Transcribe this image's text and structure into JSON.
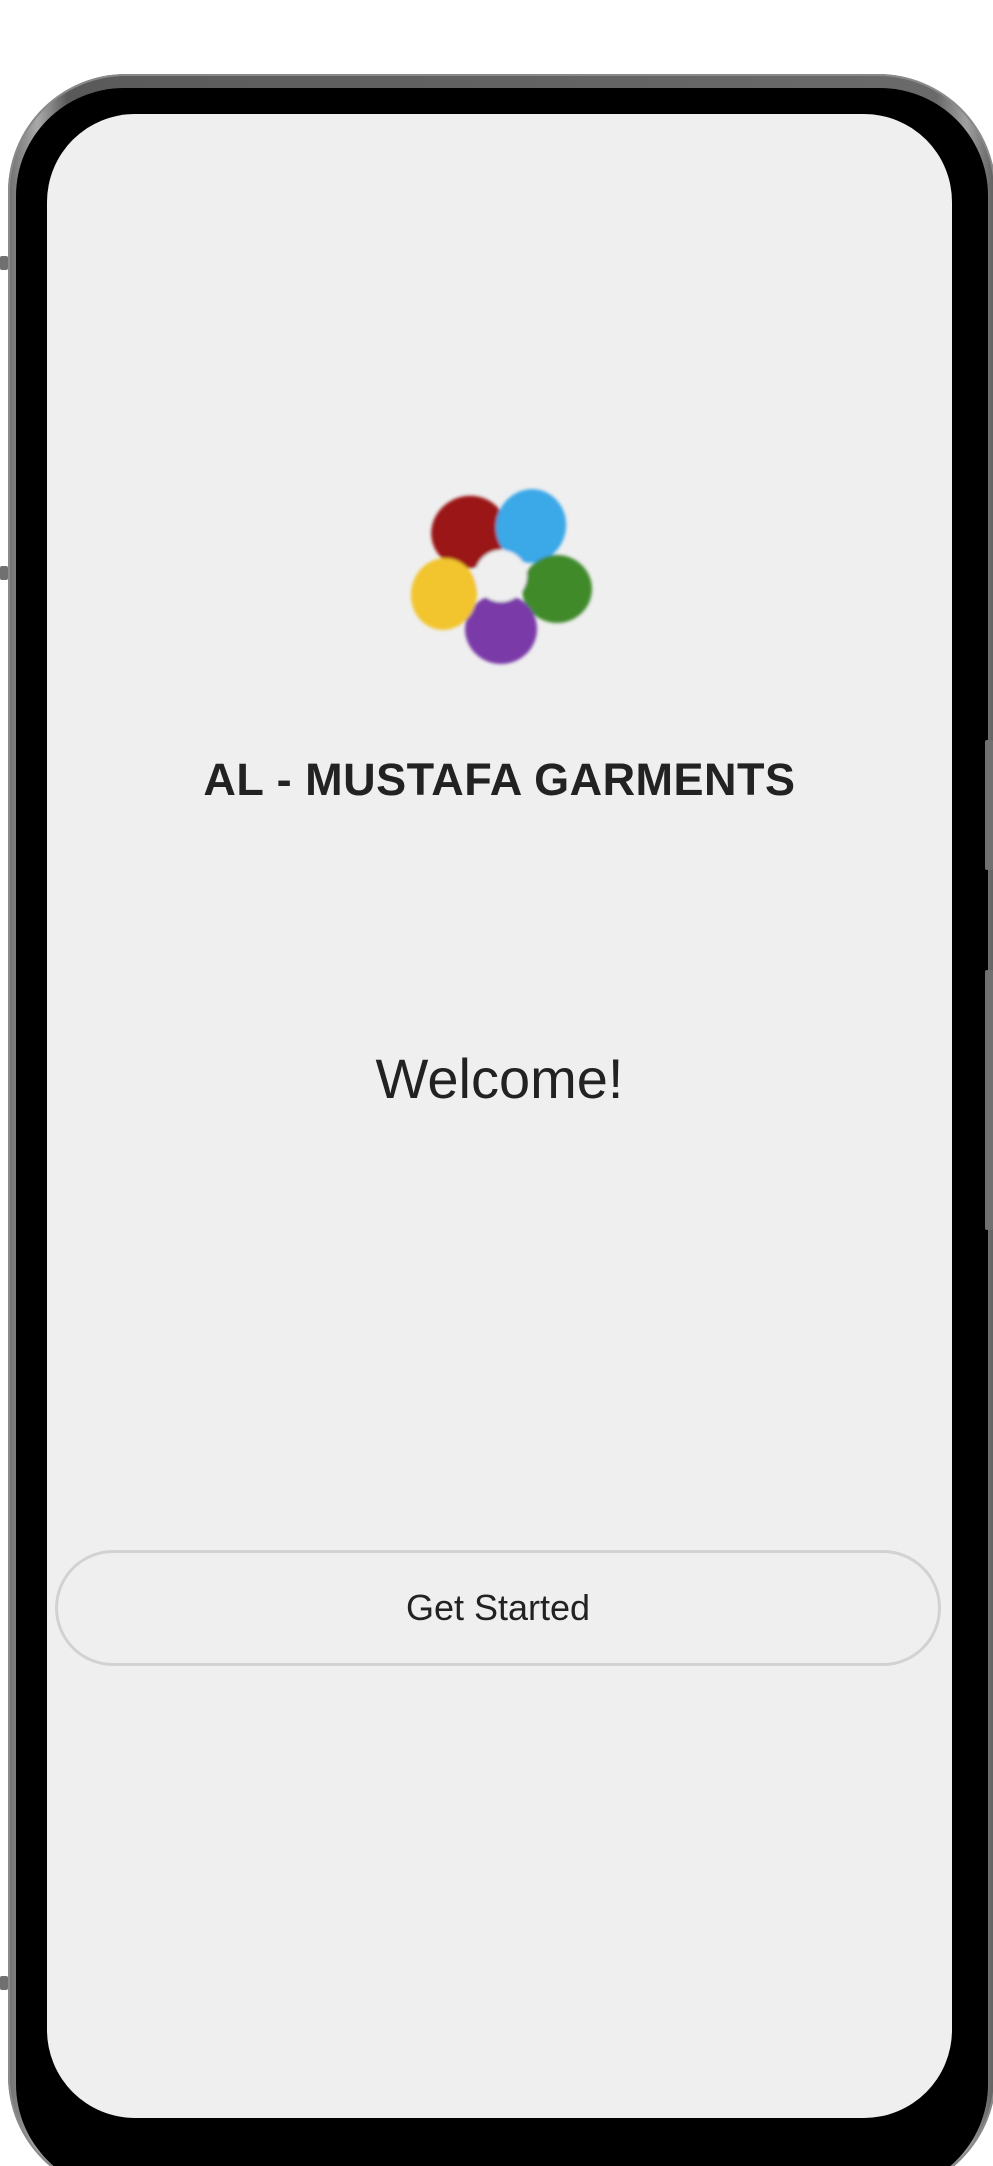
{
  "app": {
    "brand_name": "AL - MUSTAFA GARMENTS",
    "logo": {
      "icon": "flower-logo-icon",
      "petal_colors": [
        "#9b1414",
        "#3aa8e8",
        "#3f8a2c",
        "#7a3aa8",
        "#f2c52e"
      ]
    }
  },
  "main": {
    "welcome_text": "Welcome!",
    "get_started_label": "Get Started"
  }
}
